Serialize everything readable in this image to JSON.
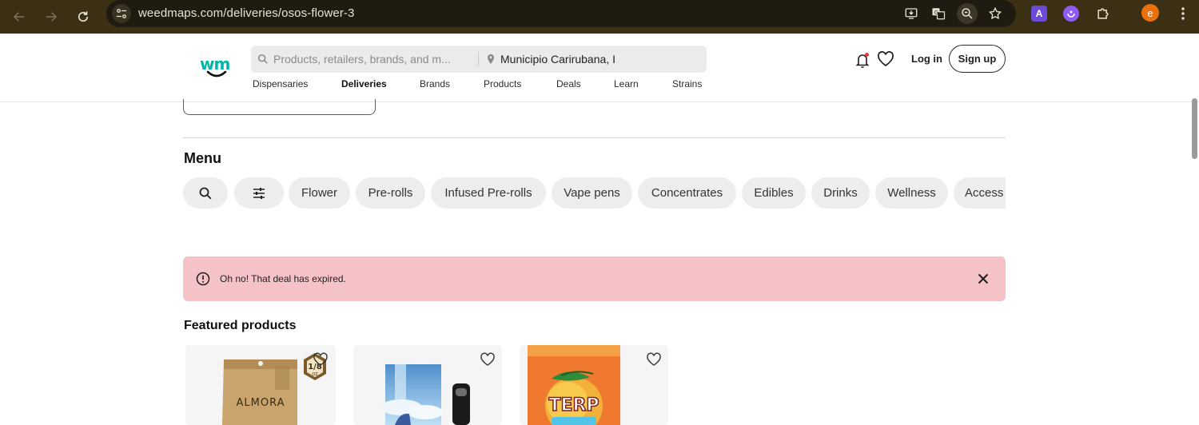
{
  "browser": {
    "url": "weedmaps.com/deliveries/osos-flower-3",
    "extension_a_letter": "A",
    "profile_initial": "e"
  },
  "header": {
    "logo_text": "wm",
    "search_placeholder": "Products, retailers, brands, and m...",
    "location_value": "Municipio Carirubana, I",
    "nav": [
      "Dispensaries",
      "Deliveries",
      "Brands",
      "Products",
      "Deals",
      "Learn",
      "Strains"
    ],
    "active_nav": "Deliveries",
    "login_label": "Log in",
    "signup_label": "Sign up"
  },
  "menu": {
    "title": "Menu",
    "chips": [
      "Flower",
      "Pre-rolls",
      "Infused Pre-rolls",
      "Vape pens",
      "Concentrates",
      "Edibles",
      "Drinks",
      "Wellness",
      "Access"
    ]
  },
  "alert": {
    "message": "Oh no! That deal has expired.",
    "bg_color": "#f5c2c8"
  },
  "featured": {
    "title": "Featured products",
    "cards": [
      {
        "brand_text": "ALMORA",
        "badge": "1/8",
        "badge_sub": "OZ"
      },
      {
        "brand_text": ""
      },
      {
        "brand_text": "TERP"
      }
    ]
  },
  "colors": {
    "brand_teal": "#00b7a5",
    "chrome_bg": "#3b2f14",
    "notification_dot": "#e0383e"
  }
}
